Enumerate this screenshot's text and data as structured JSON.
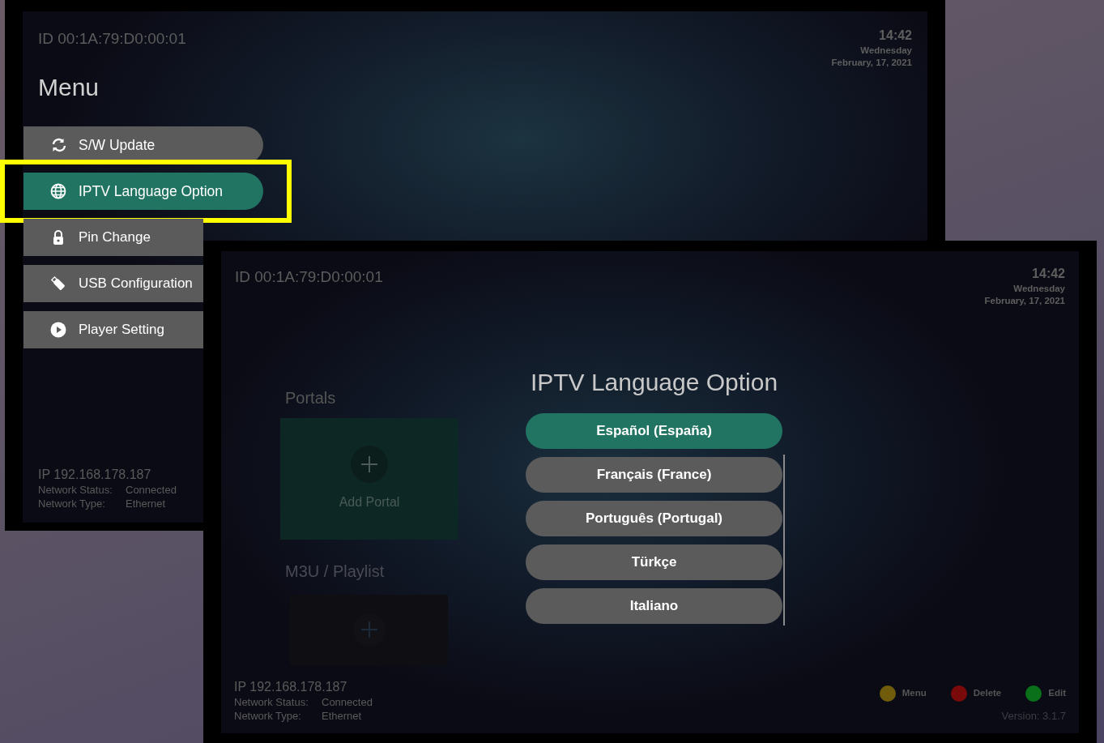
{
  "screens": [
    {
      "kind": "menu",
      "device_id": "ID 00:1A:79:D0:00:01",
      "clock": {
        "time": "14:42",
        "day": "Wednesday",
        "date": "February, 17, 2021"
      },
      "title": "Menu",
      "menu_items": [
        {
          "label": "S/W Update",
          "selected": false,
          "highlighted": false
        },
        {
          "label": "IPTV Language Option",
          "selected": true,
          "highlighted": true
        },
        {
          "label": "Pin Change",
          "selected": false,
          "highlighted": false
        },
        {
          "label": "USB Configuration",
          "selected": false,
          "highlighted": false
        },
        {
          "label": "Player Setting",
          "selected": false,
          "highlighted": false
        }
      ],
      "network": {
        "ip": "IP 192.168.178.187",
        "status_label": "Network Status:",
        "status_value": "Connected",
        "type_label": "Network Type:",
        "type_value": "Ethernet"
      }
    },
    {
      "kind": "dialog",
      "device_id": "ID 00:1A:79:D0:00:01",
      "clock": {
        "time": "14:42",
        "day": "Wednesday",
        "date": "February, 17, 2021"
      },
      "portals_heading": "Portals",
      "add_portal": "Add Portal",
      "playlist_heading": "M3U / Playlist",
      "dialog": {
        "title": "IPTV Language Option",
        "options": [
          {
            "label": "Español (España)",
            "selected": true
          },
          {
            "label": "Français (France)",
            "selected": false
          },
          {
            "label": "Português (Portugal)",
            "selected": false
          },
          {
            "label": "Türkçe",
            "selected": false
          },
          {
            "label": "Italiano",
            "selected": false
          }
        ]
      },
      "network": {
        "ip": "IP 192.168.178.187",
        "status_label": "Network Status:",
        "status_value": "Connected",
        "type_label": "Network Type:",
        "type_value": "Ethernet"
      },
      "legend": [
        {
          "label": "Menu",
          "color": "#705c0a"
        },
        {
          "label": "Delete",
          "color": "#7a0a0a"
        },
        {
          "label": "Edit",
          "color": "#0a701a"
        }
      ],
      "version": "Version: 3.1.7"
    }
  ]
}
